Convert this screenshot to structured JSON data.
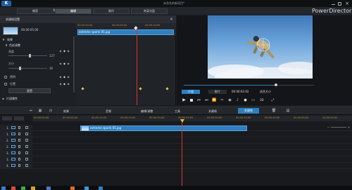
{
  "window": {
    "title": "未命名的新项目*",
    "app_name": "PowerDirector",
    "logo_letter": "K"
  },
  "menu": {
    "items": [
      "文件",
      "编辑",
      "插件",
      "视图",
      "播放",
      "帮助"
    ],
    "tabs": [
      "捕获",
      "编辑",
      "制作",
      "刻录光盘"
    ],
    "active_tab": 1
  },
  "designer": {
    "title": "关键帧设置",
    "time_display": "00:00:05:00",
    "clip_name": "extreme sports 05.jpg",
    "sections": {
      "effects_label": "效果",
      "color_label": "色彩调整",
      "attr_label": "片段属性"
    },
    "params": [
      {
        "label": "亮度",
        "value": "127"
      },
      {
        "label": "大小",
        "value": "36"
      },
      {
        "label": "透明",
        "value": ""
      },
      {
        "label": "位置",
        "value": ""
      }
    ],
    "reset_label": "重置",
    "ruler": [
      "00:00:00:00",
      "00:00:05:00",
      "00:00:10:00"
    ]
  },
  "preview": {
    "mode_clip": "片段",
    "mode_movie": "影片",
    "timecode": "00:00:02:02",
    "fit_label": "适合大小",
    "mode_3d": "3D"
  },
  "toolbar": {
    "effects": "效果",
    "audio": "音频",
    "edit_video": "编辑/调整",
    "tools": "工具",
    "keyframe": "关键帧",
    "designer": "关键帧"
  },
  "timeline": {
    "ruler": [
      "00:00:00:00",
      "00:00:05:00",
      "00:00:10:00",
      "00:00:15:00",
      "00:00:20:00",
      "00:00:25:00",
      "00:00:30:00",
      "00:00:35:00",
      "00:00:40:00",
      "00:00:45:00",
      "00:00:50:00"
    ],
    "clip_name": "extreme sports 05.jpg",
    "track_labels": [
      "1.",
      "1.",
      "2.",
      "2.",
      "3.",
      "3.",
      "4."
    ]
  },
  "colors": {
    "accent": "#2e7fc0",
    "playhead": "#d9372b",
    "keyframe": "#e8c14a"
  }
}
